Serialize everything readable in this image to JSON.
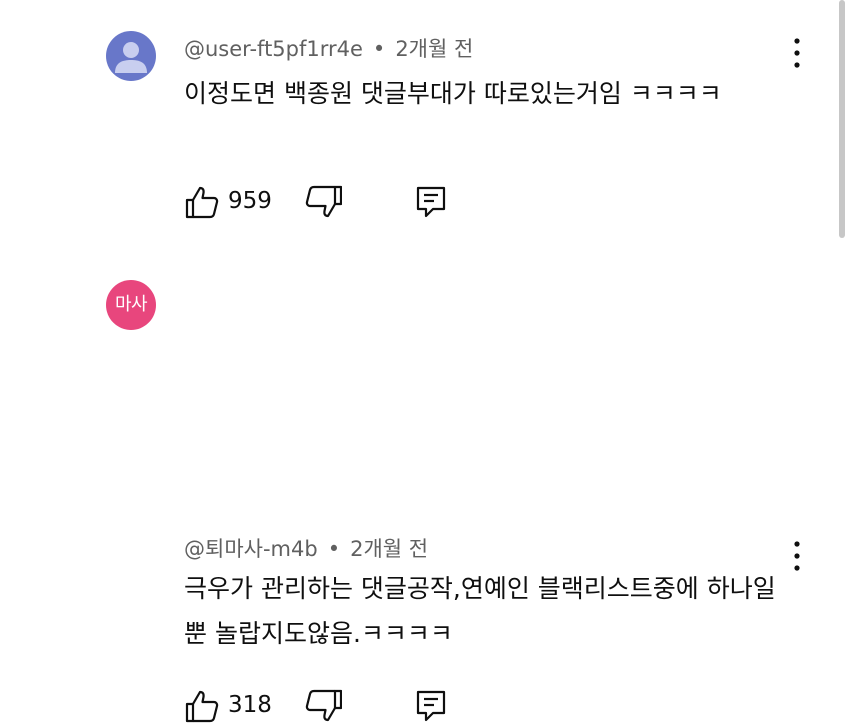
{
  "comments": [
    {
      "avatar": {
        "icon": "default-user-icon",
        "color": "#6877c9"
      },
      "author": "@user-ft5pf1rr4e",
      "separator": "•",
      "time": "2개월 전",
      "text": "이정도면 백종원 댓글부대가 따로있는거임 ㅋㅋㅋㅋ",
      "likes": "959"
    },
    {
      "avatar": {
        "initials": "마사",
        "color": "#e8467d"
      },
      "author": "@퇴마사-m4b",
      "separator": "•",
      "time": "2개월 전",
      "text": "극우가 관리하는 댓글공작,연예인 블랙리스트중에 하나일 뿐 놀랍지도않음.ㅋㅋㅋㅋ",
      "likes": "318"
    }
  ]
}
